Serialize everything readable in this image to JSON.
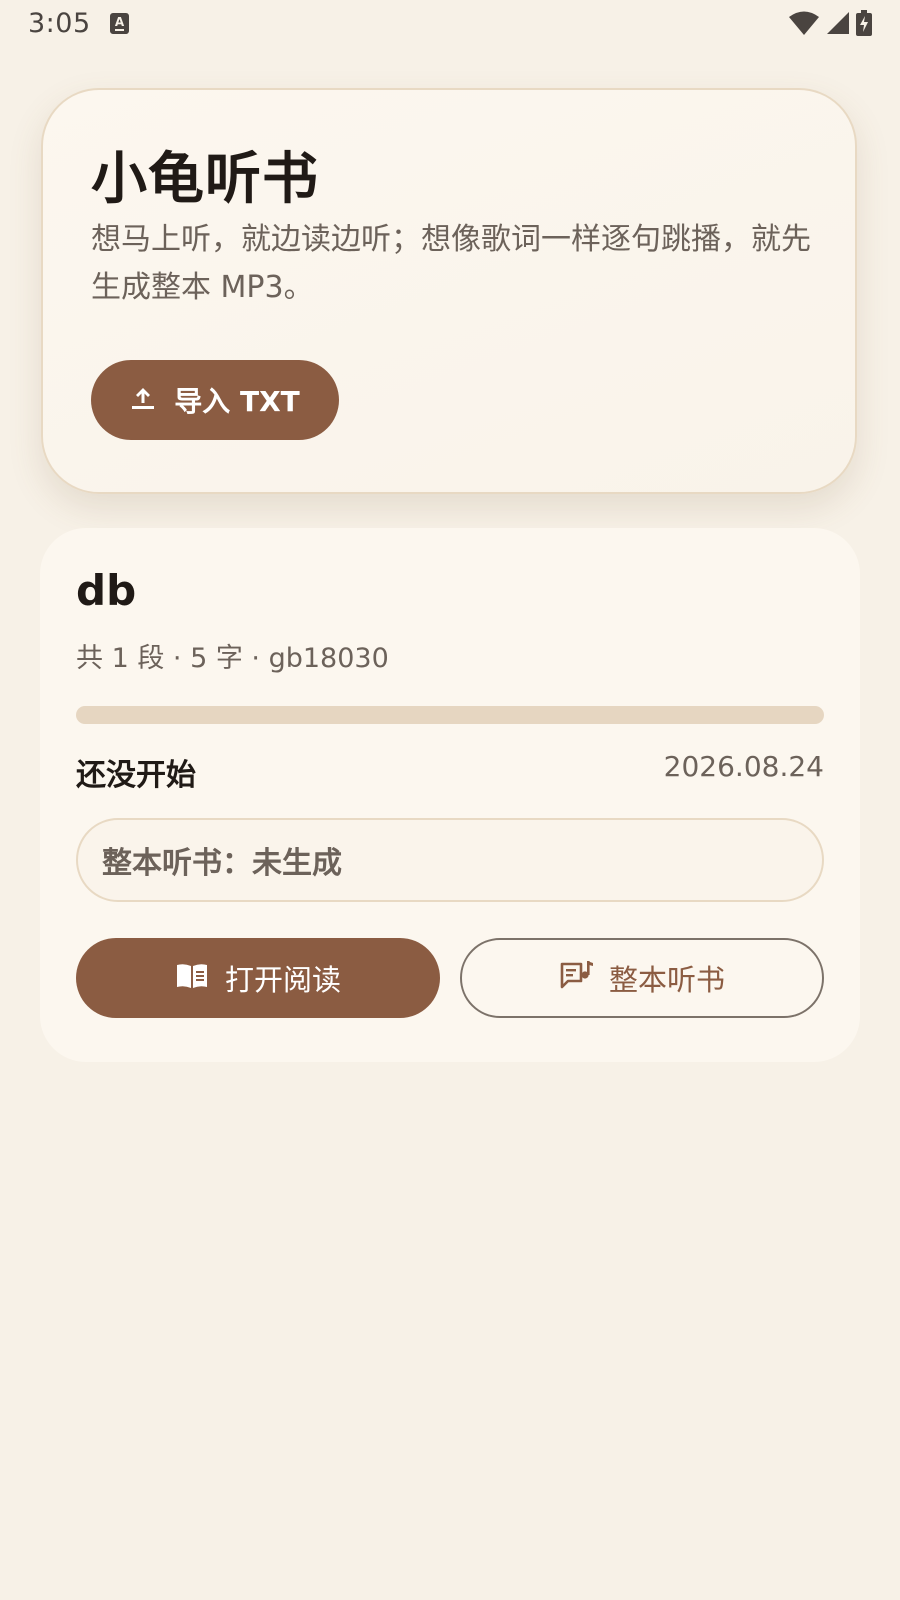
{
  "status_bar": {
    "time": "3:05",
    "icons": [
      "keyboard-a-icon",
      "wifi-icon",
      "cell-signal-icon",
      "battery-charging-icon"
    ]
  },
  "hero": {
    "title": "小龟听书",
    "subtitle": "想马上听，就边读边听；想像歌词一样逐句跳播，就先生成整本 MP3。",
    "import_button_label": "导入 TXT",
    "import_icon": "upload-icon"
  },
  "book": {
    "title": "db",
    "meta": "共 1 段 · 5 字 · gb18030",
    "progress_percent": 0,
    "status": "还没开始",
    "date": "2026.08.24",
    "audio_status": "整本听书：未生成",
    "open_read_label": "打开阅读",
    "open_read_icon": "book-open-icon",
    "whole_listen_label": "整本听书",
    "whole_listen_icon": "music-note-list-icon"
  },
  "colors": {
    "background": "#f7f1e7",
    "accent": "#8b5c42",
    "card_border": "#e8d9c3",
    "progress_track": "#e6d6c1"
  }
}
